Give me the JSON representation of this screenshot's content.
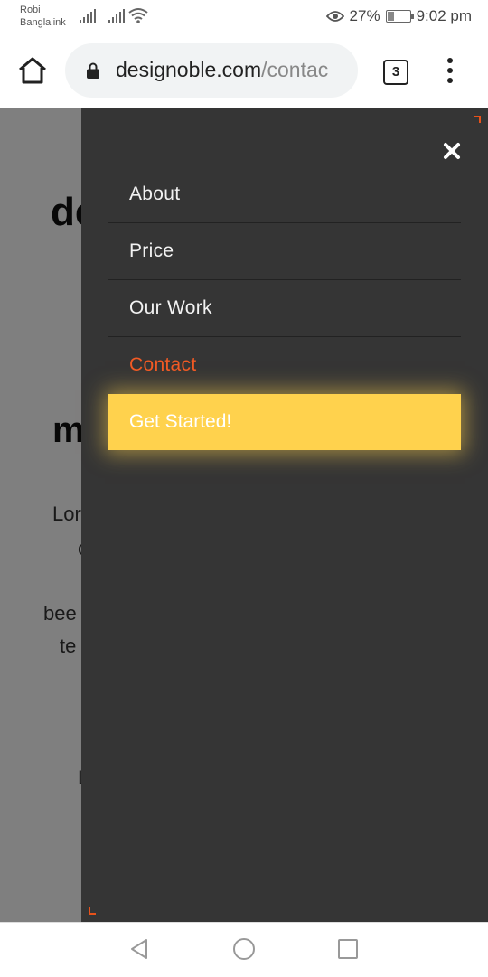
{
  "status_bar": {
    "carrier_line1": "Robi",
    "carrier_line2": "Banglalink",
    "battery_percent": "27%",
    "battery_level": 0.27,
    "time": "9:02 pm"
  },
  "browser": {
    "url_domain": "designoble.com",
    "url_path": "/contac",
    "tab_count": "3"
  },
  "page": {
    "logo_fragment": "de",
    "heading_fragment": "m",
    "para_fragments": [
      "Lor",
      "c",
      "bee",
      "te",
      "L"
    ]
  },
  "menu": {
    "items": [
      {
        "label": "About",
        "active": false
      },
      {
        "label": "Price",
        "active": false
      },
      {
        "label": "Our Work",
        "active": false
      },
      {
        "label": "Contact",
        "active": true
      }
    ],
    "cta_label": "Get Started!"
  },
  "colors": {
    "drawer_bg": "#353535",
    "accent": "#f15a24",
    "cta_bg": "#ffd24d"
  },
  "icons": {
    "home": "home-icon",
    "lock": "lock-icon",
    "more": "more-vert-icon",
    "close": "close-icon",
    "back": "back-icon",
    "nav_home": "circle-home-icon",
    "recents": "square-recents-icon"
  }
}
